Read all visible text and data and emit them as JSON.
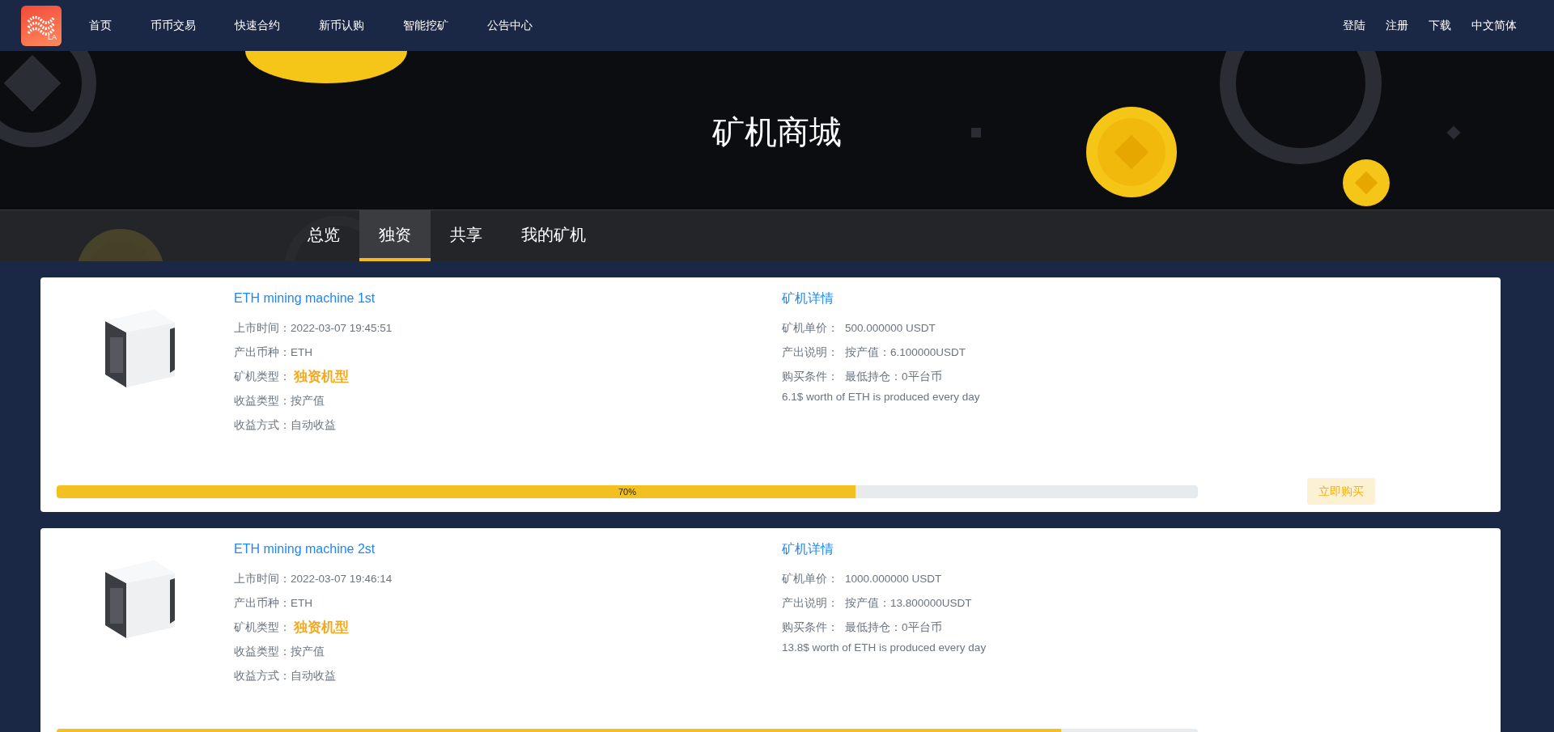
{
  "nav": {
    "logo_text": "LA",
    "items": [
      {
        "label": "首页"
      },
      {
        "label": "币币交易"
      },
      {
        "label": "快速合约"
      },
      {
        "label": "新币认购"
      },
      {
        "label": "智能挖矿"
      },
      {
        "label": "公告中心"
      }
    ],
    "right_items": [
      {
        "label": "登陆"
      },
      {
        "label": "注册"
      },
      {
        "label": "下载"
      },
      {
        "label": "中文简体"
      }
    ]
  },
  "banner": {
    "title": "矿机商城"
  },
  "tabs": [
    {
      "label": "总览",
      "selected": false
    },
    {
      "label": "独资",
      "selected": true
    },
    {
      "label": "共享",
      "selected": false
    },
    {
      "label": "我的矿机",
      "selected": false
    }
  ],
  "machines": [
    {
      "name": "ETH mining machine 1st",
      "fields": [
        {
          "label": "上市时间：",
          "value": "2022-03-07 19:45:51"
        },
        {
          "label": "产出币种：",
          "value": "ETH"
        },
        {
          "label": "矿机类型：",
          "value": "独资机型",
          "highlight": true
        },
        {
          "label": "收益类型：",
          "value": "按产值"
        },
        {
          "label": "收益方式：",
          "value": "自动收益"
        }
      ],
      "details_title": "矿机详情",
      "details": [
        {
          "label": "矿机单价：",
          "value": "500.000000 USDT"
        },
        {
          "label": "产出说明：",
          "value": "按产值：6.100000USDT"
        },
        {
          "label": "购买条件：",
          "value": "最低持仓：0平台币"
        }
      ],
      "note": "6.1$ worth of ETH is produced every day",
      "progress": {
        "level": 0.7,
        "label": "70%"
      },
      "button": "立即购买"
    },
    {
      "name": "ETH mining machine 2st",
      "fields": [
        {
          "label": "上市时间：",
          "value": "2022-03-07 19:46:14"
        },
        {
          "label": "产出币种：",
          "value": "ETH"
        },
        {
          "label": "矿机类型：",
          "value": "独资机型",
          "highlight": true
        },
        {
          "label": "收益类型：",
          "value": "按产值"
        },
        {
          "label": "收益方式：",
          "value": "自动收益"
        }
      ],
      "details_title": "矿机详情",
      "details": [
        {
          "label": "矿机单价：",
          "value": "1000.000000 USDT"
        },
        {
          "label": "产出说明：",
          "value": "按产值：13.800000USDT"
        },
        {
          "label": "购买条件：",
          "value": "最低持仓：0平台币"
        }
      ],
      "note": "13.8$ worth of ETH is produced every day",
      "progress": {
        "level": 0.88
      }
    }
  ]
}
